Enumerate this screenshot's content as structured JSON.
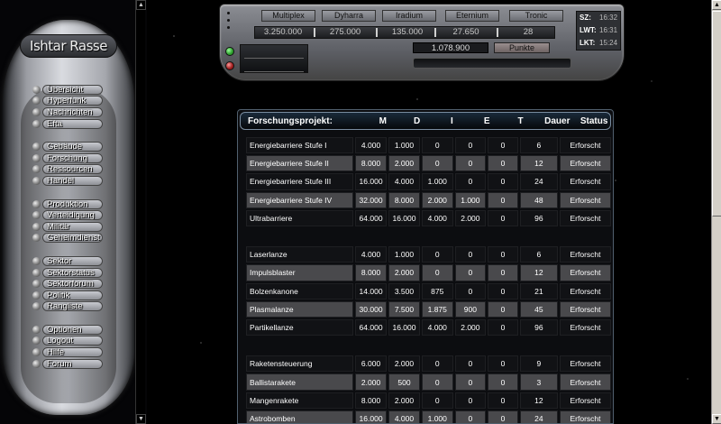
{
  "header": {
    "logo": "Ishtar Rasse"
  },
  "nav": {
    "groups": [
      [
        {
          "label": "Übersicht"
        },
        {
          "label": "Hyperfunk"
        },
        {
          "label": "Nachrichten"
        },
        {
          "label": "Efta"
        }
      ],
      [
        {
          "label": "Gebäude"
        },
        {
          "label": "Forschung"
        },
        {
          "label": "Ressourcen"
        },
        {
          "label": "Handel"
        }
      ],
      [
        {
          "label": "Produktion"
        },
        {
          "label": "Verteidigung"
        },
        {
          "label": "Militär"
        },
        {
          "label": "Geheimdienst"
        }
      ],
      [
        {
          "label": "Sektor"
        },
        {
          "label": "Sektorstatus"
        },
        {
          "label": "Sektorforum"
        },
        {
          "label": "Politik"
        },
        {
          "label": "Rangliste"
        }
      ],
      [
        {
          "label": "Optionen"
        },
        {
          "label": "Logout"
        },
        {
          "label": "Hilfe"
        },
        {
          "label": "Forum"
        }
      ]
    ]
  },
  "resources": {
    "names": [
      "Multiplex",
      "Dyharra",
      "Iradium",
      "Eternium",
      "Tronic"
    ],
    "values": [
      "3.250.000",
      "275.000",
      "135.000",
      "27.650",
      "28"
    ],
    "points_value": "1.078.900",
    "points_label": "Punkte",
    "status_colors": [
      "#2a9a2a",
      "#9a1a1a"
    ]
  },
  "times": [
    {
      "label": "SZ:",
      "value": "16:32"
    },
    {
      "label": "LWT:",
      "value": "16:31"
    },
    {
      "label": "LKT:",
      "value": "15:24"
    }
  ],
  "table": {
    "headers": [
      "Forschungsprojekt:",
      "M",
      "D",
      "I",
      "E",
      "T",
      "Dauer",
      "Status"
    ],
    "groups": [
      [
        {
          "name": "Energiebarriere Stufe I",
          "m": "4.000",
          "d": "1.000",
          "i": "0",
          "e": "0",
          "t": "0",
          "dauer": "6",
          "status": "Erforscht"
        },
        {
          "name": "Energiebarriere Stufe II",
          "m": "8.000",
          "d": "2.000",
          "i": "0",
          "e": "0",
          "t": "0",
          "dauer": "12",
          "status": "Erforscht"
        },
        {
          "name": "Energiebarriere Stufe III",
          "m": "16.000",
          "d": "4.000",
          "i": "1.000",
          "e": "0",
          "t": "0",
          "dauer": "24",
          "status": "Erforscht"
        },
        {
          "name": "Energiebarriere Stufe IV",
          "m": "32.000",
          "d": "8.000",
          "i": "2.000",
          "e": "1.000",
          "t": "0",
          "dauer": "48",
          "status": "Erforscht"
        },
        {
          "name": "Ultrabarriere",
          "m": "64.000",
          "d": "16.000",
          "i": "4.000",
          "e": "2.000",
          "t": "0",
          "dauer": "96",
          "status": "Erforscht"
        }
      ],
      [
        {
          "name": "Laserlanze",
          "m": "4.000",
          "d": "1.000",
          "i": "0",
          "e": "0",
          "t": "0",
          "dauer": "6",
          "status": "Erforscht"
        },
        {
          "name": "Impulsblaster",
          "m": "8.000",
          "d": "2.000",
          "i": "0",
          "e": "0",
          "t": "0",
          "dauer": "12",
          "status": "Erforscht"
        },
        {
          "name": "Bolzenkanone",
          "m": "14.000",
          "d": "3.500",
          "i": "875",
          "e": "0",
          "t": "0",
          "dauer": "21",
          "status": "Erforscht"
        },
        {
          "name": "Plasmalanze",
          "m": "30.000",
          "d": "7.500",
          "i": "1.875",
          "e": "900",
          "t": "0",
          "dauer": "45",
          "status": "Erforscht"
        },
        {
          "name": "Partikellanze",
          "m": "64.000",
          "d": "16.000",
          "i": "4.000",
          "e": "2.000",
          "t": "0",
          "dauer": "96",
          "status": "Erforscht"
        }
      ],
      [
        {
          "name": "Raketensteuerung",
          "m": "6.000",
          "d": "2.000",
          "i": "0",
          "e": "0",
          "t": "0",
          "dauer": "9",
          "status": "Erforscht"
        },
        {
          "name": "Ballistarakete",
          "m": "2.000",
          "d": "500",
          "i": "0",
          "e": "0",
          "t": "0",
          "dauer": "3",
          "status": "Erforscht"
        },
        {
          "name": "Mangenrakete",
          "m": "8.000",
          "d": "2.000",
          "i": "0",
          "e": "0",
          "t": "0",
          "dauer": "12",
          "status": "Erforscht"
        },
        {
          "name": "Astrobomben",
          "m": "16.000",
          "d": "4.000",
          "i": "1.000",
          "e": "0",
          "t": "0",
          "dauer": "24",
          "status": "Erforscht"
        }
      ]
    ]
  }
}
